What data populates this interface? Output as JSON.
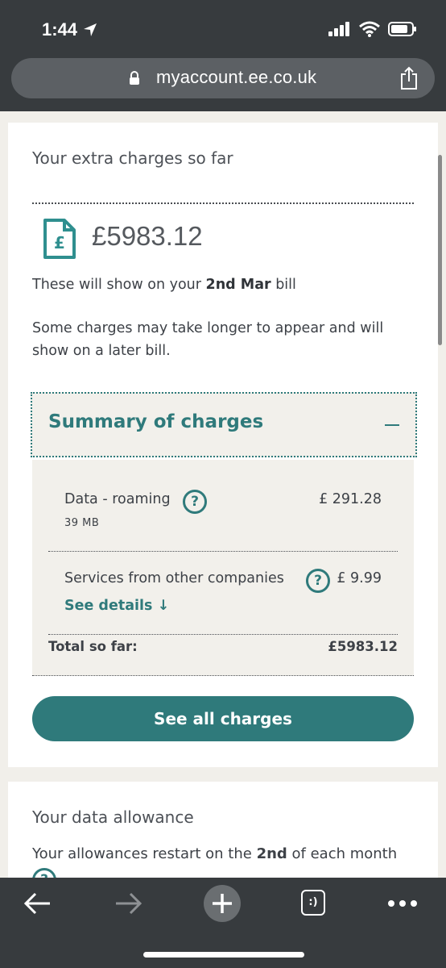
{
  "status_bar": {
    "time": "1:44"
  },
  "browser": {
    "url": "myaccount.ee.co.uk"
  },
  "charges_card": {
    "title": "Your extra charges so far",
    "amount": "£5983.12",
    "bill_note_prefix": "These will show on your ",
    "bill_note_date": "2nd Mar",
    "bill_note_suffix": " bill",
    "delay_note": "Some charges may take longer to appear and will show on a later bill.",
    "summary": {
      "title": "Summary of charges",
      "rows": [
        {
          "label": "Data - roaming",
          "sublabel": "39 MB",
          "value": "£ 291.28"
        },
        {
          "label": "Services from other companies",
          "value": "£ 9.99",
          "link": "See details ↓"
        }
      ],
      "total_label": "Total so far:",
      "total_value": "£5983.12"
    },
    "button_label": "See all charges"
  },
  "data_card": {
    "title": "Your data allowance",
    "restart_prefix": "Your allowances restart on the ",
    "restart_day": "2nd",
    "restart_suffix": " of each month"
  },
  "colors": {
    "accent": "#2f7a7b",
    "chrome": "#373b3e",
    "panel": "#f2f0eb"
  },
  "icons": [
    "location-arrow-icon",
    "signal-icon",
    "wifi-icon",
    "battery-icon",
    "lock-icon",
    "share-icon",
    "bill-document-icon",
    "help-icon",
    "back-arrow-icon",
    "forward-arrow-icon",
    "new-tab-icon",
    "tabs-icon",
    "more-icon"
  ],
  "bottom_nav": {
    "tabs_label": ":)"
  }
}
